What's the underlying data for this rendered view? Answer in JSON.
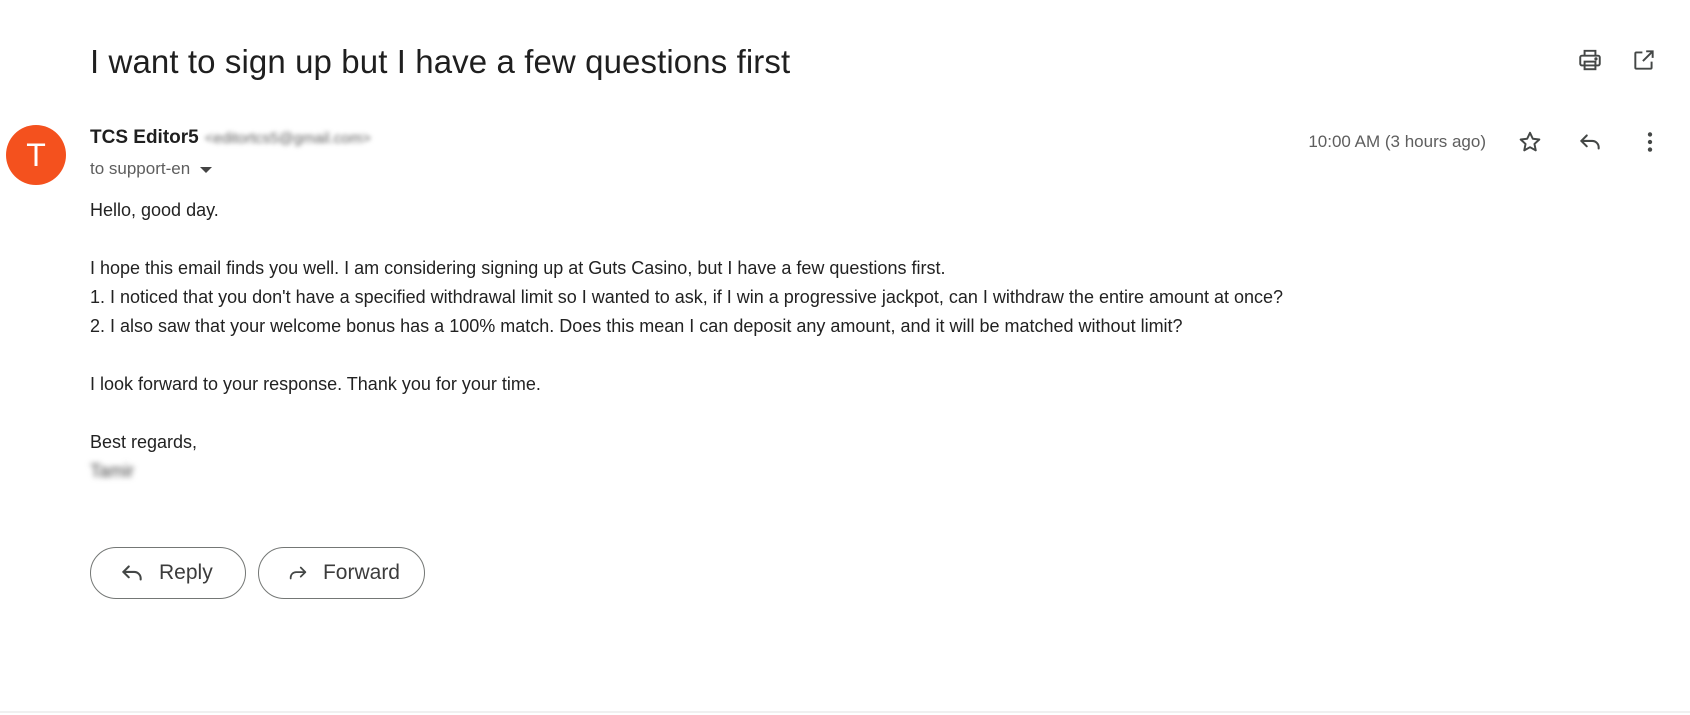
{
  "email": {
    "subject": "I want to sign up but I have a few questions first",
    "sender": {
      "avatar_letter": "T",
      "avatar_color": "#f4511e",
      "name": "TCS Editor5",
      "email": "<editortcs5@gmail.com>"
    },
    "to": "to support-en",
    "timestamp": "10:00 AM (3 hours ago)",
    "body": {
      "greeting": "Hello, good day.",
      "line1": "I hope this email finds you well. I am considering signing up at Guts Casino, but I have a few questions first.",
      "line2": "1. I noticed that you don't have a specified withdrawal limit so I wanted to ask, if I win a progressive jackpot, can I withdraw the entire amount at once?",
      "line3": "2. I also saw that your welcome bonus has a 100% match. Does this mean I can deposit any amount, and it will be matched without limit?",
      "closing": "I look forward to your response. Thank you for your time.",
      "signoff": "Best regards,",
      "signature": "Tamir"
    }
  },
  "toolbar": {
    "print_icon": "print-icon",
    "open_new_window_icon": "open-in-new-window-icon"
  },
  "meta_actions": {
    "star_icon": "star-icon",
    "reply_icon": "reply-icon",
    "more_icon": "more-vert-icon"
  },
  "actions": {
    "reply_label": "Reply",
    "forward_label": "Forward"
  }
}
